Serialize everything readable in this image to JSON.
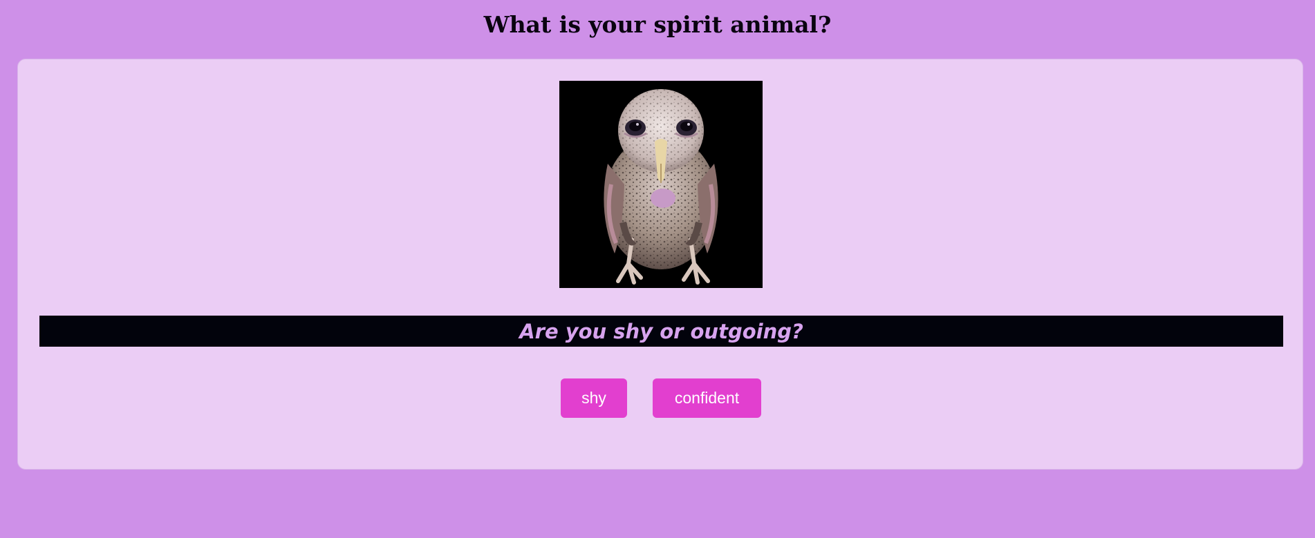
{
  "page": {
    "title": "What is your spirit animal?"
  },
  "quiz": {
    "image_alt": "owl",
    "question": "Are you shy or outgoing?",
    "answers": [
      {
        "label": "shy"
      },
      {
        "label": "confident"
      }
    ]
  },
  "colors": {
    "page_background": "#ce90e8",
    "card_background": "#ebcdf5",
    "question_bar": "#02030c",
    "question_text": "#d7a3ee",
    "button": "#e23fcf",
    "button_text": "#ffffff"
  }
}
